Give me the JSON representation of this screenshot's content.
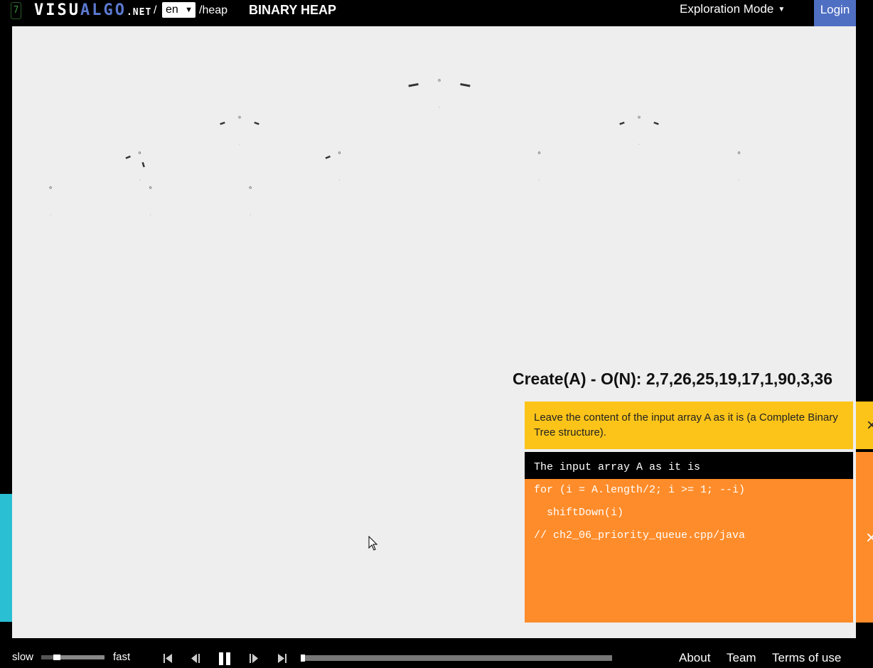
{
  "header": {
    "badge": "7",
    "logo_part1": "VISU",
    "logo_part2": "ALGO",
    "logo_net": ".NET",
    "slash": "/",
    "language": "en",
    "path": "/heap",
    "title": "BINARY HEAP",
    "mode": "Exploration Mode",
    "login": "Login"
  },
  "status": {
    "title": "Create(A) - O(N): 2,7,26,25,19,17,1,90,3,36",
    "description": "Leave the content of the input array A as it is (a Complete Binary Tree structure).",
    "close_icon": "×"
  },
  "code": {
    "lines": [
      "The input array A as it is",
      "for (i = A.length/2; i >= 1; --i)",
      "  shiftDown(i)",
      "// ch2_06_priority_queue.cpp/java"
    ],
    "active_line": 0,
    "close_icon": "×"
  },
  "tree": {
    "node_count": 10
  },
  "controls": {
    "slow": "slow",
    "fast": "fast",
    "speed_fraction": 0.25,
    "progress_fraction": 0.0
  },
  "footer": {
    "about": "About",
    "team": "Team",
    "terms": "Terms of use"
  },
  "colors": {
    "login_bg": "#4f6fc3",
    "description_bg": "#fcc419",
    "code_bg": "#ff8c2a",
    "side_tab": "#2bbfd3",
    "canvas_bg": "#eeeeee"
  }
}
